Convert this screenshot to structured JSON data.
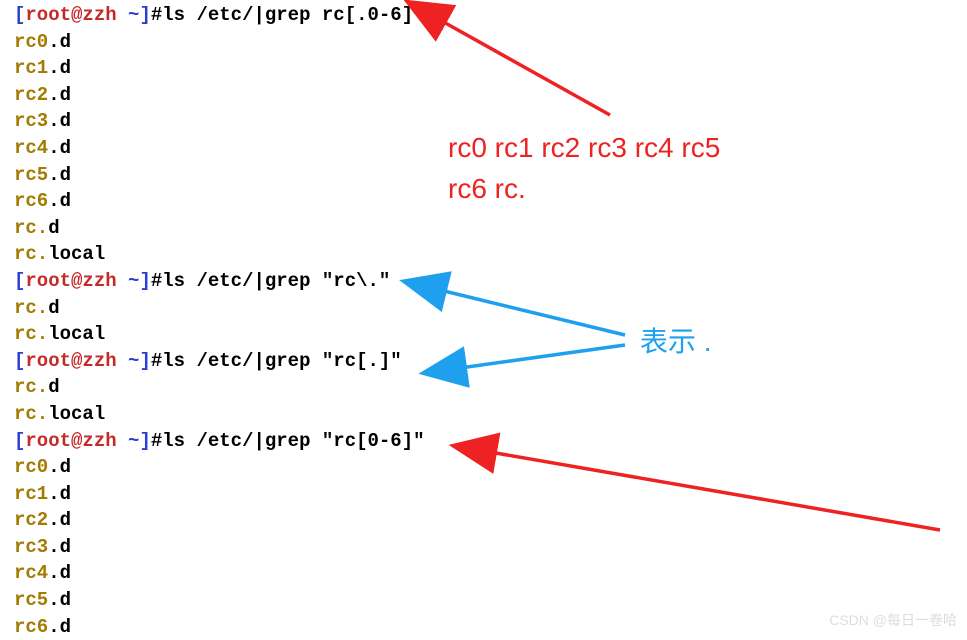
{
  "prompt": {
    "open_bracket": "[",
    "user": "root",
    "at": "@",
    "host": "zzh",
    "space_tilde": " ~",
    "close_bracket": "]",
    "hash": "#"
  },
  "commands": {
    "cmd1": "ls /etc/|grep rc[.0-6]",
    "cmd2": "ls /etc/|grep \"rc\\.\"",
    "cmd3": "ls /etc/|grep \"rc[.]\"",
    "cmd4": "ls /etc/|grep \"rc[0-6]\""
  },
  "outputs": {
    "block1": [
      {
        "match": "rc0",
        "rest": ".d"
      },
      {
        "match": "rc1",
        "rest": ".d"
      },
      {
        "match": "rc2",
        "rest": ".d"
      },
      {
        "match": "rc3",
        "rest": ".d"
      },
      {
        "match": "rc4",
        "rest": ".d"
      },
      {
        "match": "rc5",
        "rest": ".d"
      },
      {
        "match": "rc6",
        "rest": ".d"
      },
      {
        "match": "rc.",
        "rest": "d"
      },
      {
        "match": "rc.",
        "rest": "local"
      }
    ],
    "block2": [
      {
        "match": "rc.",
        "rest": "d"
      },
      {
        "match": "rc.",
        "rest": "local"
      }
    ],
    "block3": [
      {
        "match": "rc.",
        "rest": "d"
      },
      {
        "match": "rc.",
        "rest": "local"
      }
    ],
    "block4": [
      {
        "match": "rc0",
        "rest": ".d"
      },
      {
        "match": "rc1",
        "rest": ".d"
      },
      {
        "match": "rc2",
        "rest": ".d"
      },
      {
        "match": "rc3",
        "rest": ".d"
      },
      {
        "match": "rc4",
        "rest": ".d"
      },
      {
        "match": "rc5",
        "rest": ".d"
      },
      {
        "match": "rc6",
        "rest": ".d"
      }
    ]
  },
  "annotations": {
    "red_text_line1": "rc0 rc1 rc2 rc3 rc4 rc5",
    "red_text_line2": "rc6 rc.",
    "blue_text": "表示  ."
  },
  "watermark": "CSDN @每日一卷哈"
}
